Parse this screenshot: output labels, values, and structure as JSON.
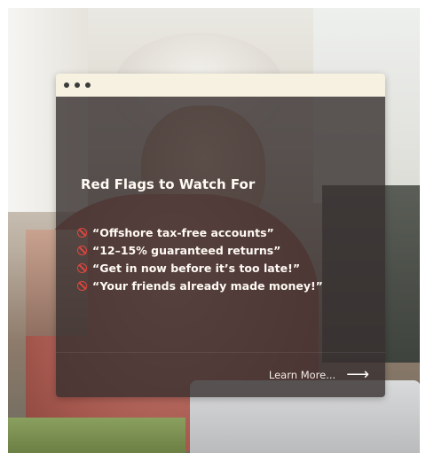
{
  "window": {
    "title_dots": [
      "dot",
      "dot",
      "dot"
    ]
  },
  "card": {
    "heading": "Red Flags to Watch For",
    "flag_icon": "no-entry-icon",
    "flags": [
      "“Offshore tax-free accounts”",
      "“12–15% guaranteed returns”",
      "“Get in now before it’s too late!”",
      "“Your friends already made money!”"
    ],
    "cta_label": "Learn More...",
    "cta_icon": "arrow-right-icon"
  },
  "colors": {
    "titlebar": "#f7f1e1",
    "panel": "#372f2f",
    "flag_icon": "#e0463e",
    "text": "#fffaf3"
  }
}
